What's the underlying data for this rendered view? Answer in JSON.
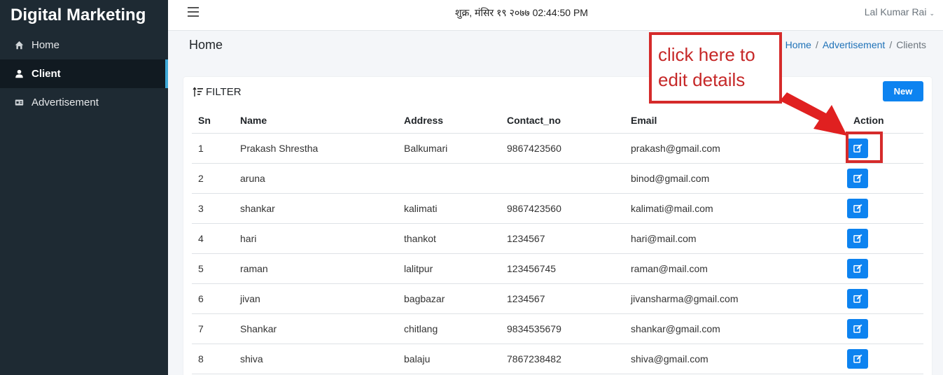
{
  "sidebar": {
    "brand": "Digital Marketing",
    "items": [
      {
        "label": "Home",
        "icon": "home-icon",
        "active": false
      },
      {
        "label": "Client",
        "icon": "user-icon",
        "active": true
      },
      {
        "label": "Advertisement",
        "icon": "ad-icon",
        "active": false
      }
    ]
  },
  "topbar": {
    "datetime": "शुक्र, मंसिर १९ २०७७ 02:44:50 PM",
    "user": "Lal Kumar Rai",
    "caret": "⌄"
  },
  "header": {
    "title": "Home",
    "breadcrumb": [
      "Home",
      "Advertisement",
      "Clients"
    ],
    "separator": "/"
  },
  "card": {
    "filter_label": "FILTER",
    "new_label": "New"
  },
  "table": {
    "columns": [
      "Sn",
      "Name",
      "Address",
      "Contact_no",
      "Email",
      "Action"
    ],
    "rows": [
      [
        "1",
        "Prakash Shrestha",
        "Balkumari",
        "9867423560",
        "prakash@gmail.com"
      ],
      [
        "2",
        "aruna",
        "",
        "",
        "binod@gmail.com"
      ],
      [
        "3",
        "shankar",
        "kalimati",
        "9867423560",
        "kalimati@mail.com"
      ],
      [
        "4",
        "hari",
        "thankot",
        "1234567",
        "hari@mail.com"
      ],
      [
        "5",
        "raman",
        "lalitpur",
        "123456745",
        "raman@mail.com"
      ],
      [
        "6",
        "jivan",
        "bagbazar",
        "1234567",
        "jivansharma@gmail.com"
      ],
      [
        "7",
        "Shankar",
        "chitlang",
        "9834535679",
        "shankar@gmail.com"
      ],
      [
        "8",
        "shiva",
        "balaju",
        "7867238482",
        "shiva@gmail.com"
      ]
    ]
  },
  "annotation": {
    "text": "click here to edit details",
    "color": "#d52b2b"
  },
  "colors": {
    "sidebar_bg": "#1e2a33",
    "active_indicator": "#3fa9d8",
    "primary": "#0d83f0",
    "link": "#1f72b8"
  }
}
